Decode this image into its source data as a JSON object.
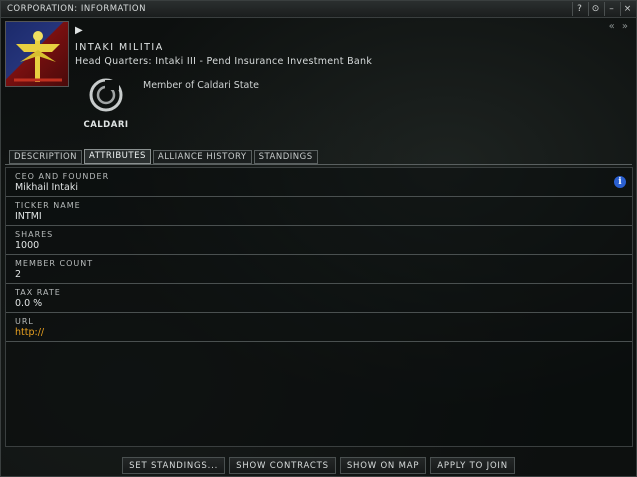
{
  "window": {
    "title": "CORPORATION: INFORMATION",
    "controls": [
      "?",
      "⊙",
      "–",
      "×"
    ]
  },
  "header": {
    "corp_name": "INTAKI MILITIA",
    "head_quarters": "Head Quarters: Intaki III - Pend Insurance Investment Bank",
    "member_of": "Member of Caldari State",
    "alliance_logo_text": "CALDARI"
  },
  "tabs": [
    {
      "label": "DESCRIPTION",
      "active": false
    },
    {
      "label": "ATTRIBUTES",
      "active": true
    },
    {
      "label": "ALLIANCE HISTORY",
      "active": false
    },
    {
      "label": "STANDINGS",
      "active": false
    }
  ],
  "attributes": [
    {
      "label": "CEO AND FOUNDER",
      "value": "Mikhail Intaki"
    },
    {
      "label": "TICKER NAME",
      "value": "INTMI"
    },
    {
      "label": "SHARES",
      "value": "1000"
    },
    {
      "label": "MEMBER COUNT",
      "value": "2"
    },
    {
      "label": "TAX RATE",
      "value": "0.0 %"
    },
    {
      "label": "URL",
      "value": "http://"
    }
  ],
  "buttons": {
    "set_standings": "SET STANDINGS...",
    "show_contracts": "SHOW CONTRACTS",
    "show_on_map": "SHOW ON MAP",
    "apply_to_join": "APPLY TO JOIN"
  },
  "colors": {
    "link": "#e8a020",
    "info_icon": "#2a5fd0"
  },
  "icons": [
    "info-icon",
    "collapse-icon",
    "expand-icon",
    "help-icon",
    "pin-icon",
    "minimize-icon",
    "close-icon"
  ]
}
